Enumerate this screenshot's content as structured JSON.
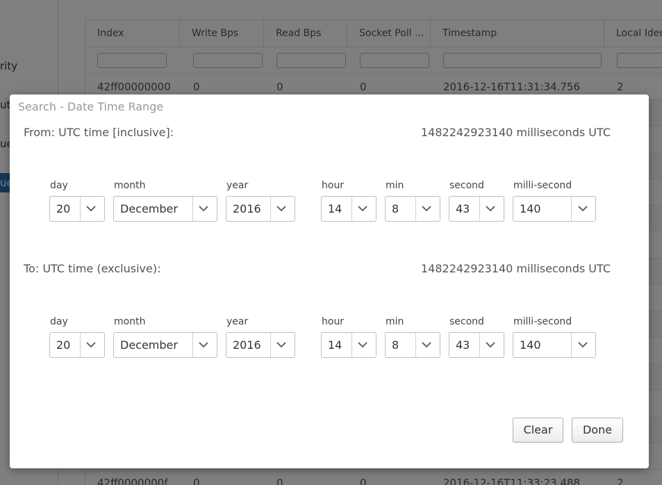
{
  "background": {
    "sidebar_items": [
      "rity",
      "ut",
      "ue"
    ],
    "sidebar_active": "ue",
    "table": {
      "columns": [
        "Index",
        "Write Bps",
        "Read Bps",
        "Socket Poll ...",
        "Timestamp",
        "Local Iden"
      ],
      "rows": [
        [
          "42ff00000000",
          "0",
          "0",
          "0",
          "2016-12-16T11:31:34.756",
          "2"
        ],
        [
          "42ff0000000f",
          "0",
          "0",
          "0",
          "2016-12-16T11:33:23.488",
          "2"
        ]
      ]
    }
  },
  "dialog": {
    "title": "Search - Date Time Range",
    "from": {
      "label": "From: UTC time [inclusive]:",
      "ms_text": "1482242923140 milliseconds UTC",
      "fields": {
        "day": {
          "label": "day",
          "value": "20"
        },
        "month": {
          "label": "month",
          "value": "December"
        },
        "year": {
          "label": "year",
          "value": "2016"
        },
        "hour": {
          "label": "hour",
          "value": "14"
        },
        "min": {
          "label": "min",
          "value": "8"
        },
        "second": {
          "label": "second",
          "value": "43"
        },
        "ms": {
          "label": "milli-second",
          "value": "140"
        }
      }
    },
    "to": {
      "label": "To: UTC time (exclusive):",
      "ms_text": "1482242923140 milliseconds UTC",
      "fields": {
        "day": {
          "label": "day",
          "value": "20"
        },
        "month": {
          "label": "month",
          "value": "December"
        },
        "year": {
          "label": "year",
          "value": "2016"
        },
        "hour": {
          "label": "hour",
          "value": "14"
        },
        "min": {
          "label": "min",
          "value": "8"
        },
        "second": {
          "label": "second",
          "value": "43"
        },
        "ms": {
          "label": "milli-second",
          "value": "140"
        }
      }
    },
    "buttons": {
      "clear": "Clear",
      "done": "Done"
    }
  },
  "icons": {
    "select_arrow": "chevron-down-icon"
  },
  "colors": {
    "overlay": "#000000",
    "accent": "#2f6fb5"
  }
}
